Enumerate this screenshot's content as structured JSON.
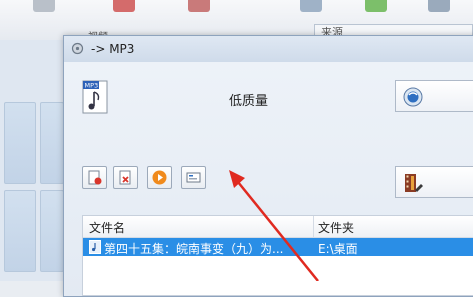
{
  "background": {
    "label": "视频",
    "tab": "来源"
  },
  "dialog": {
    "title": "-> MP3",
    "quality": "低质量",
    "list": {
      "columns": [
        "文件名",
        "文件夹"
      ],
      "rows": [
        {
          "filename": "第四十五集：皖南事变（九）为...",
          "folder": "E:\\桌面",
          "selected": true
        }
      ]
    }
  },
  "colors": {
    "selection": "#2a8ee6",
    "arrow": "#e02a20"
  }
}
